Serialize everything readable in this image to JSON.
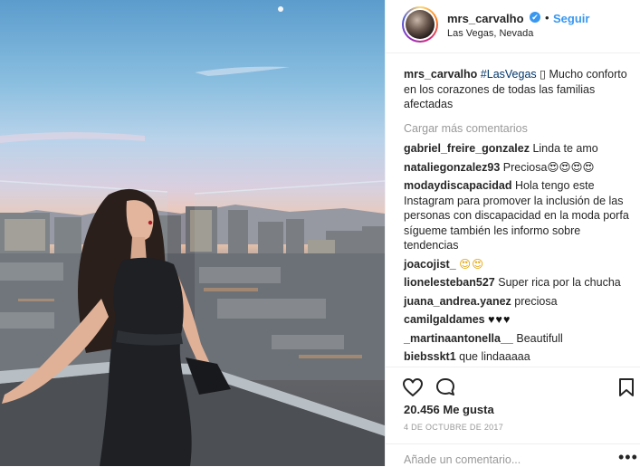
{
  "post": {
    "username": "mrs_carvalho",
    "verified_badge": "✔",
    "separator": "•",
    "follow_label": "Seguir",
    "location": "Las Vegas, Nevada",
    "caption": {
      "user": "mrs_carvalho",
      "hashtag": "#LasVegas",
      "glyph": "▯",
      "text": "Mucho conforto en los corazones de todas las familias afectadas"
    },
    "load_more": "Cargar más comentarios",
    "comments": [
      {
        "user": "gabriel_freire_gonzalez",
        "text": "Linda te amo"
      },
      {
        "user": "nataliegonzalez93",
        "text": "Preciosa😍😍😍😍"
      },
      {
        "user": "modaydiscapacidad",
        "text": "Hola tengo este Instagram para promover la inclusión de las personas con discapacidad en la moda porfa sígueme también les informo sobre tendencias"
      },
      {
        "user": "joacojist_",
        "text": "😍😍"
      },
      {
        "user": "lionelesteban527",
        "text": "Super rica por la chucha"
      },
      {
        "user": "juana_andrea.yanez",
        "text": "preciosa"
      },
      {
        "user": "camilgaldames",
        "text": "♥♥♥"
      },
      {
        "user": "_martinaantonella__",
        "text": "Beautifull"
      },
      {
        "user": "biebsskt1",
        "text": "que lindaaaaa"
      }
    ],
    "likes": "20.456 Me gusta",
    "date": "4 DE OCTUBRE DE 2017",
    "comment_placeholder": "Añade un comentario...",
    "more_label": "•••",
    "icons": [
      "heart-icon",
      "comment-icon",
      "bookmark-icon",
      "verified-icon"
    ]
  }
}
